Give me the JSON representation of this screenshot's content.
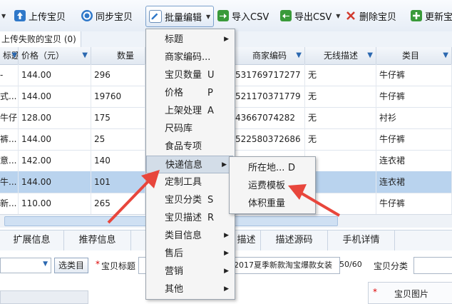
{
  "toolbar": {
    "upload": "上传宝贝",
    "sync": "同步宝贝",
    "batch_edit": "批量编辑",
    "import_csv": "导入CSV",
    "export_csv": "导出CSV",
    "delete": "删除宝贝",
    "update": "更新宝"
  },
  "tab_fail": "上传失败的宝贝 (0)",
  "table": {
    "headers": [
      "标题",
      "价格（元）",
      "数量",
      "商家编码",
      "无线描述",
      "类目"
    ],
    "rows": [
      {
        "title": "-",
        "price": "144.00",
        "qty": "296",
        "code": "531769717277",
        "wireless": "无",
        "cat": "牛仔裤",
        "selected": false
      },
      {
        "title": "式...",
        "price": "144.00",
        "qty": "19760",
        "code": "521170371779",
        "wireless": "无",
        "cat": "牛仔裤",
        "selected": false
      },
      {
        "title": "牛仔...",
        "price": "128.00",
        "qty": "175",
        "code": "43667074282",
        "wireless": "无",
        "cat": "衬衫",
        "selected": false
      },
      {
        "title": "裤...",
        "price": "144.00",
        "qty": "25",
        "code": "522580372686",
        "wireless": "无",
        "cat": "牛仔裤",
        "selected": false
      },
      {
        "title": "意...",
        "price": "142.00",
        "qty": "140",
        "code": "",
        "wireless": "",
        "cat": "连衣裙",
        "selected": false
      },
      {
        "title": "牛...",
        "price": "144.00",
        "qty": "101",
        "code": "",
        "wireless": "",
        "cat": "连衣裙",
        "selected": true
      },
      {
        "title": "新...",
        "price": "110.00",
        "qty": "265",
        "code": "",
        "wireless": "",
        "cat": "牛仔裤",
        "selected": false
      }
    ]
  },
  "lower_tabs": [
    "扩展信息",
    "推荐信息",
    "描述",
    "描述源码",
    "手机详情"
  ],
  "form": {
    "select_btn": "选类目",
    "title_label": "宝贝标题",
    "title_value": "2017夏季新款淘宝爆款女装",
    "count": "50/60",
    "category_label": "宝贝分类",
    "image_label": "宝贝图片",
    "required": "*"
  },
  "menu": [
    {
      "label": "标题",
      "key": "",
      "sub": true
    },
    {
      "label": "商家编码...",
      "key": "",
      "sub": false
    },
    {
      "label": "宝贝数量",
      "key": "U",
      "sub": false
    },
    {
      "label": "价格",
      "key": "P",
      "sub": false
    },
    {
      "label": "上架处理",
      "key": "A",
      "sub": false
    },
    {
      "label": "尺码库",
      "key": "",
      "sub": false
    },
    {
      "label": "食品专项",
      "key": "",
      "sub": false
    },
    {
      "label": "快递信息",
      "key": "",
      "sub": true
    },
    {
      "label": "定制工具",
      "key": "",
      "sub": false
    },
    {
      "label": "宝贝分类",
      "key": "S",
      "sub": false
    },
    {
      "label": "宝贝描述",
      "key": "R",
      "sub": false
    },
    {
      "label": "类目信息",
      "key": "",
      "sub": true
    },
    {
      "label": "售后",
      "key": "",
      "sub": true
    },
    {
      "label": "营销",
      "key": "",
      "sub": true
    },
    {
      "label": "其他",
      "key": "",
      "sub": true
    }
  ],
  "submenu": [
    {
      "label": "所在地...",
      "key": "D"
    },
    {
      "label": "运费模板",
      "key": ""
    },
    {
      "label": "体积重量",
      "key": ""
    }
  ],
  "colors": {
    "accent": "#2b68b0",
    "selected_row": "#b9d3ee",
    "arrow": "#e8463c"
  }
}
